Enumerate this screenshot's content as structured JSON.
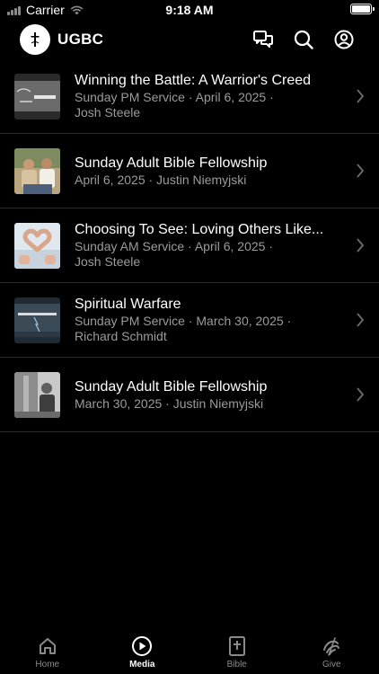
{
  "status_bar": {
    "carrier": "Carrier",
    "time": "9:18 AM"
  },
  "header": {
    "title": "UGBC",
    "logo_icon": "cross-logo",
    "icons": [
      "chat-icon",
      "search-icon",
      "account-icon"
    ]
  },
  "media": {
    "items": [
      {
        "title": "Winning the Battle: A Warrior's Creed",
        "line1": "Sunday PM Service · April 6, 2025 ·",
        "line2": "Josh Steele",
        "thumb": "warrior-thumbnail"
      },
      {
        "title": "Sunday Adult Bible Fellowship",
        "line1": "April 6, 2025 · Justin Niemyjski",
        "line2": "",
        "thumb": "fellowship-photo"
      },
      {
        "title": "Choosing To See: Loving Others Like...",
        "line1": "Sunday AM Service · April 6, 2025 ·",
        "line2": "Josh Steele",
        "thumb": "heart-hands-photo"
      },
      {
        "title": "Spiritual Warfare",
        "line1": "Sunday PM Service · March 30, 2025 ·",
        "line2": "Richard Schmidt",
        "thumb": "spiritual-warfare-thumbnail"
      },
      {
        "title": "Sunday Adult Bible Fellowship",
        "line1": "March 30, 2025 · Justin Niemyjski",
        "line2": "",
        "thumb": "fellowship-photo"
      }
    ]
  },
  "tabs": [
    {
      "label": "Home",
      "icon": "home-icon",
      "active": false
    },
    {
      "label": "Media",
      "icon": "play-icon",
      "active": true
    },
    {
      "label": "Bible",
      "icon": "bible-icon",
      "active": false
    },
    {
      "label": "Give",
      "icon": "give-icon",
      "active": false
    }
  ],
  "colors": {
    "background": "#000000",
    "text_primary": "#ffffff",
    "text_secondary": "#9b9b9b",
    "divider": "#2b2b2b",
    "tab_inactive": "#8a8a8a"
  }
}
